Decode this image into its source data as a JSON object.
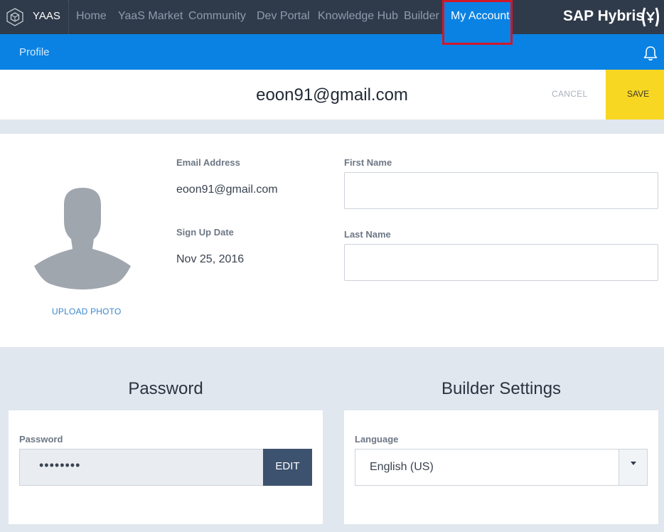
{
  "nav": {
    "logo_label": "YAAS",
    "items": [
      "Home",
      "YaaS Market",
      "Community",
      "Dev Portal",
      "Knowledge Hub",
      "Builder"
    ],
    "active_item": "My Account",
    "brand": "SAP Hybris"
  },
  "subbar": {
    "title": "Profile"
  },
  "header": {
    "email": "eoon91@gmail.com",
    "cancel_label": "CANCEL",
    "save_label": "SAVE"
  },
  "profile": {
    "upload_label": "UPLOAD PHOTO",
    "email_label": "Email Address",
    "email_value": "eoon91@gmail.com",
    "signup_label": "Sign Up Date",
    "signup_value": "Nov 25, 2016",
    "first_name_label": "First Name",
    "first_name_value": "",
    "last_name_label": "Last Name",
    "last_name_value": ""
  },
  "password_section": {
    "title": "Password",
    "field_label": "Password",
    "masked_value": "••••••••",
    "edit_label": "EDIT"
  },
  "builder_section": {
    "title": "Builder Settings",
    "language_label": "Language",
    "language_value": "English (US)"
  },
  "colors": {
    "nav_bg": "#2f3a4a",
    "accent_blue": "#0a82e3",
    "save_yellow": "#f8d723",
    "highlight_red": "#d0182b",
    "edit_button": "#3d526e"
  }
}
